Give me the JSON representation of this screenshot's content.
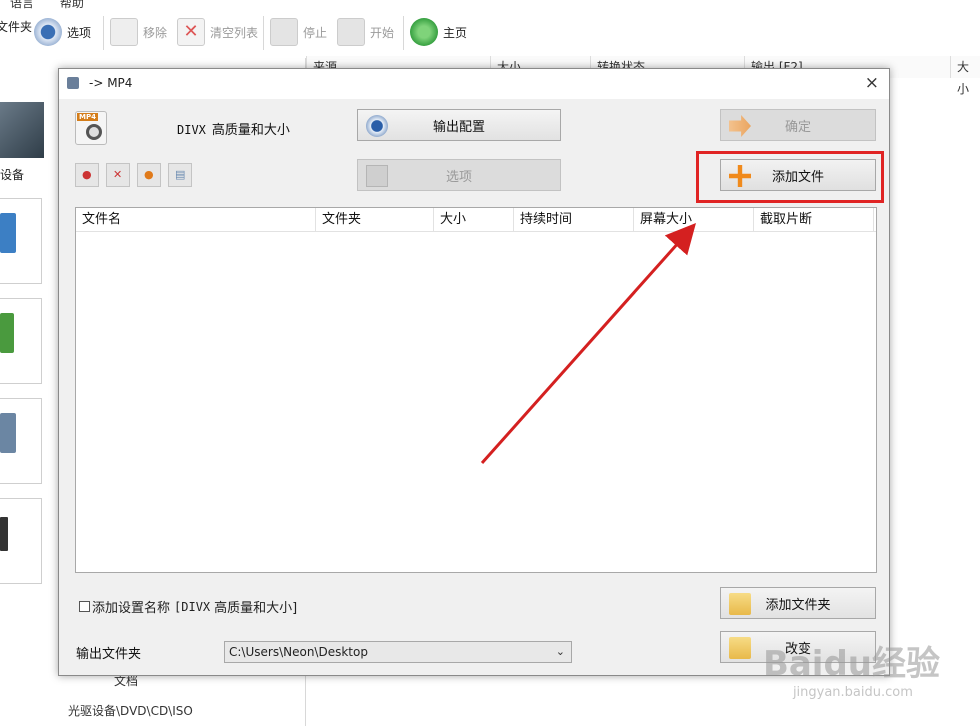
{
  "background_app": {
    "menu_peek": [
      "语言",
      "帮助"
    ],
    "toolbar": [
      {
        "label": "文件夹",
        "disabled": false
      },
      {
        "label": "选项",
        "disabled": false
      },
      {
        "label": "移除",
        "disabled": true
      },
      {
        "label": "清空列表",
        "disabled": true
      },
      {
        "label": "停止",
        "disabled": true
      },
      {
        "label": "开始",
        "disabled": true
      },
      {
        "label": "主页",
        "disabled": false
      }
    ],
    "columns": [
      "来源",
      "大小",
      "转换状态",
      "输出 [F2]",
      "大小"
    ],
    "left_label_devices": "设备",
    "bottom_items": [
      "文档",
      "光驱设备\\DVD\\CD\\ISO"
    ]
  },
  "dialog": {
    "title": "-> MP4",
    "close_glyph": "×",
    "format_tag": "MP4",
    "profile": {
      "codec": "DIVX",
      "quality": "高质量和大小"
    },
    "buttons": {
      "output_config": "输出配置",
      "options": "选项",
      "ok": "确定",
      "add_file": "添加文件",
      "add_folder": "添加文件夹",
      "change": "改变"
    },
    "file_list_columns": [
      "文件名",
      "文件夹",
      "大小",
      "持续时间",
      "屏幕大小",
      "截取片断"
    ],
    "add_profile_name": {
      "prefix": "添加设置名称",
      "codec": "[DIVX",
      "quality": "高质量和大小]",
      "checked": false
    },
    "output_folder": {
      "label": "输出文件夹",
      "value": "C:\\Users\\Neon\\Desktop"
    }
  },
  "watermark": {
    "brand": "Baidu经验",
    "url": "jingyan.baidu.com"
  },
  "colors": {
    "highlight": "#e02424",
    "arrow": "#d42020",
    "dialog_bg": "#f0f0f0"
  }
}
